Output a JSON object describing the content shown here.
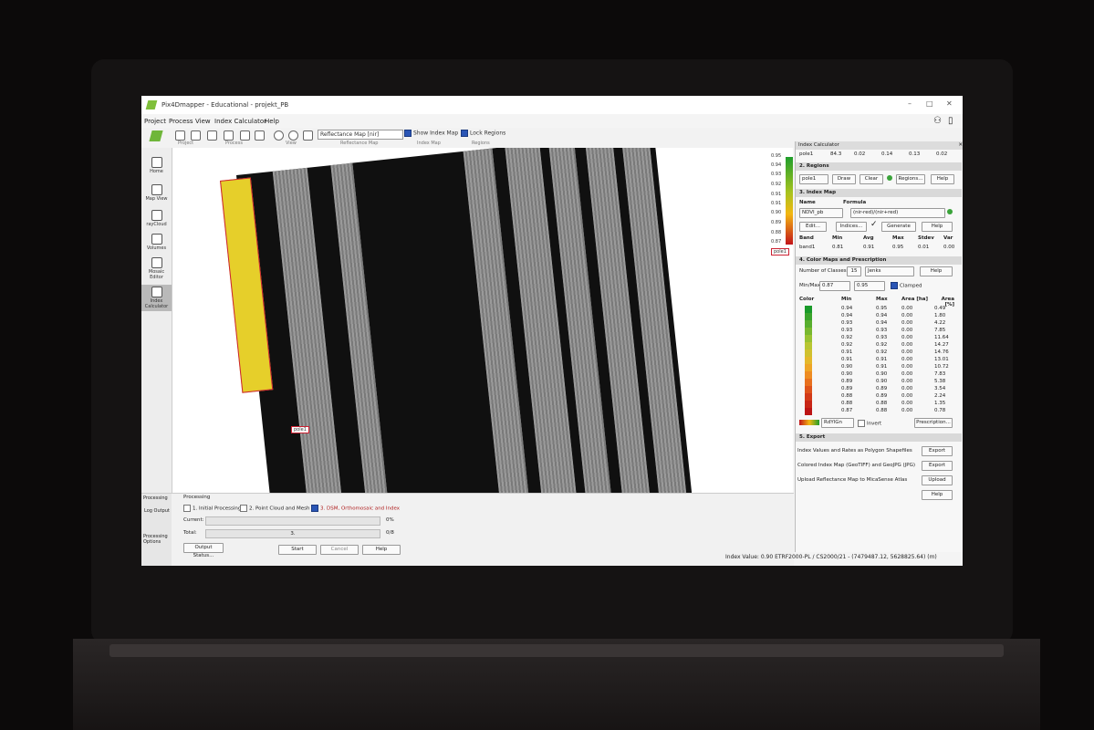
{
  "window": {
    "title": "Pix4Dmapper - Educational - projekt_PB"
  },
  "menu": [
    "Project",
    "Process",
    "View",
    "Index Calculator",
    "Help"
  ],
  "toolbar": {
    "groups": [
      "Project",
      "Process",
      "View",
      "Reflectance Map",
      "Index Map",
      "Regions"
    ],
    "reflectance_select": "Reflectance Map [nir]",
    "show_index_map": "Show Index Map",
    "lock_regions": "Lock Regions"
  },
  "sidebar": [
    {
      "label": "Home",
      "icon": "home-icon"
    },
    {
      "label": "Map View",
      "icon": "map-icon"
    },
    {
      "label": "rayCloud",
      "icon": "raycloud-icon"
    },
    {
      "label": "Volumes",
      "icon": "volumes-icon"
    },
    {
      "label": "Mosaic Editor",
      "icon": "mosaic-icon"
    },
    {
      "label": "Index Calculator",
      "icon": "index-calculator-icon"
    }
  ],
  "map": {
    "region_label": "pole1"
  },
  "legend": {
    "values": [
      "0.95",
      "0.94",
      "0.93",
      "0.92",
      "0.91",
      "0.91",
      "0.90",
      "0.89",
      "0.88",
      "0.87"
    ],
    "region_tag": "pole1"
  },
  "panel": {
    "title": "Index Calculator",
    "top_row": [
      "pole1",
      "84.3",
      "0.02",
      "0.14",
      "0.13",
      "0.02"
    ],
    "regions": {
      "header": "2. Regions",
      "select": "pole1",
      "draw": "Draw",
      "clear": "Clear",
      "regions": "Regions...",
      "help": "Help"
    },
    "index_map": {
      "header": "3. Index Map",
      "name_label": "Name",
      "formula_label": "Formula",
      "name": "NDVI_pb",
      "formula": "(nir-red)/(nir+red)",
      "edit": "Edit...",
      "indices": "Indices...",
      "generate": "Generate",
      "help": "Help",
      "stats_headers": [
        "Band",
        "Min",
        "Avg",
        "Max",
        "Stdev",
        "Var"
      ],
      "stats_row": [
        "band1",
        "0.81",
        "0.91",
        "0.95",
        "0.01",
        "0.00"
      ]
    },
    "color_maps": {
      "header": "4. Color Maps and Prescription",
      "classes_label": "Number of Classes",
      "classes": "15",
      "method": "Jenks",
      "help": "Help",
      "minmax_label": "Min/Max",
      "min": "0.87",
      "max": "0.95",
      "clamped": "Clamped",
      "table_headers": [
        "Color",
        "Min",
        "Max",
        "Area [ha]",
        "Area [%]"
      ],
      "rows": [
        {
          "color": "#1a9a2a",
          "min": "0.94",
          "max": "0.95",
          "area_ha": "0.00",
          "area_pct": "0.49"
        },
        {
          "color": "#3aa42c",
          "min": "0.94",
          "max": "0.94",
          "area_ha": "0.00",
          "area_pct": "1.80"
        },
        {
          "color": "#58ae2e",
          "min": "0.93",
          "max": "0.94",
          "area_ha": "0.00",
          "area_pct": "4.22"
        },
        {
          "color": "#78b82f",
          "min": "0.93",
          "max": "0.93",
          "area_ha": "0.00",
          "area_pct": "7.85"
        },
        {
          "color": "#98c231",
          "min": "0.92",
          "max": "0.93",
          "area_ha": "0.00",
          "area_pct": "11.64"
        },
        {
          "color": "#b8c632",
          "min": "0.92",
          "max": "0.92",
          "area_ha": "0.00",
          "area_pct": "14.27"
        },
        {
          "color": "#d0c12f",
          "min": "0.91",
          "max": "0.92",
          "area_ha": "0.00",
          "area_pct": "14.76"
        },
        {
          "color": "#e4b82b",
          "min": "0.91",
          "max": "0.91",
          "area_ha": "0.00",
          "area_pct": "13.01"
        },
        {
          "color": "#eea526",
          "min": "0.90",
          "max": "0.91",
          "area_ha": "0.00",
          "area_pct": "10.72"
        },
        {
          "color": "#ee8c22",
          "min": "0.90",
          "max": "0.90",
          "area_ha": "0.00",
          "area_pct": "7.83"
        },
        {
          "color": "#e8701e",
          "min": "0.89",
          "max": "0.90",
          "area_ha": "0.00",
          "area_pct": "5.38"
        },
        {
          "color": "#de531b",
          "min": "0.89",
          "max": "0.89",
          "area_ha": "0.00",
          "area_pct": "3.54"
        },
        {
          "color": "#d23a18",
          "min": "0.88",
          "max": "0.89",
          "area_ha": "0.00",
          "area_pct": "2.24"
        },
        {
          "color": "#c82616",
          "min": "0.88",
          "max": "0.88",
          "area_ha": "0.00",
          "area_pct": "1.35"
        },
        {
          "color": "#bc1414",
          "min": "0.87",
          "max": "0.88",
          "area_ha": "0.00",
          "area_pct": "0.78"
        }
      ],
      "colormap": "RdYlGn",
      "invert": "Invert",
      "prescription": "Prescription..."
    },
    "export": {
      "header": "5. Export",
      "items": [
        {
          "label": "Index Values and Rates as Polygon Shapefiles",
          "button": "Export"
        },
        {
          "label": "Colored Index Map (GeoTIFF) and GeoJPG (JPG)",
          "button": "Export"
        },
        {
          "label": "Upload Reflectance Map to MicaSense Atlas",
          "button": "Upload"
        }
      ],
      "help": "Help"
    }
  },
  "processing": {
    "title": "Processing",
    "steps": [
      "1. Initial Processing",
      "2. Point Cloud and Mesh",
      "3. DSM, Orthomosaic and Index"
    ],
    "current_label": "Current:",
    "current_pct": "0%",
    "total_label": "Total:",
    "total_value": "3.",
    "total_count": "0/8",
    "output_status": "Output Status...",
    "start": "Start",
    "cancel": "Cancel",
    "help": "Help",
    "left_items": [
      "Processing",
      "Log Output",
      "Processing Options"
    ]
  },
  "status": {
    "text": "Index Value: 0.90 ETRF2000-PL / CS2000/21 - (7479487.12, 5628825.64) (m)"
  }
}
